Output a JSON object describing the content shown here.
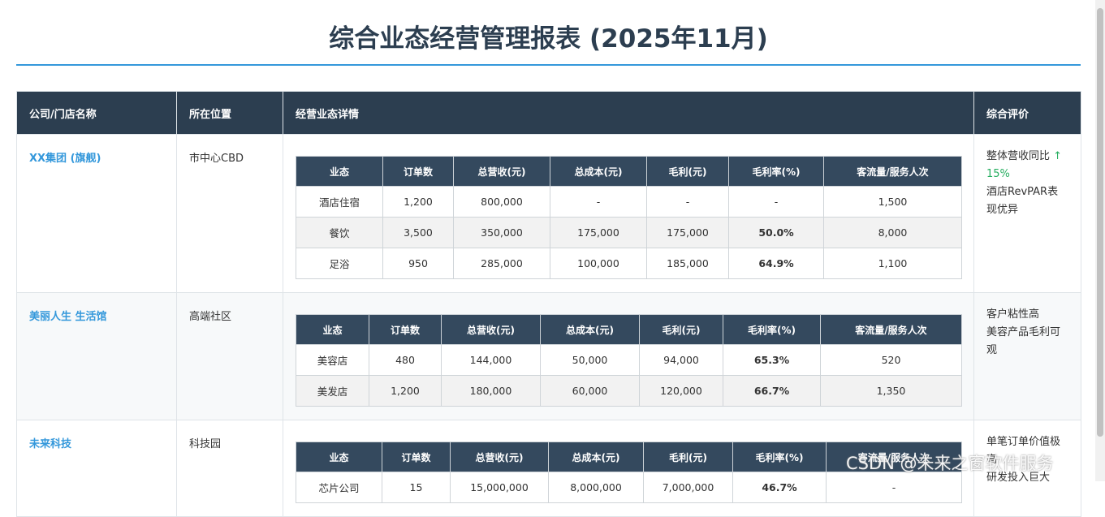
{
  "title": "综合业态经营管理报表 (2025年11月)",
  "headers": [
    "公司/门店名称",
    "所在位置",
    "经营业态详情",
    "综合评价"
  ],
  "sub_headers": [
    "业态",
    "订单数",
    "总营收(元)",
    "总成本(元)",
    "毛利(元)",
    "毛利率(%)",
    "客流量/服务人次"
  ],
  "companies": [
    {
      "name": "XX集团 (旗舰)",
      "location": "市中心CBD",
      "eval_line1": "整体营收同比",
      "eval_trend": "↑ 15%",
      "eval_line2": "酒店RevPAR表现优异",
      "rows": [
        [
          "酒店住宿",
          "1,200",
          "800,000",
          "-",
          "-",
          "-",
          "1,500"
        ],
        [
          "餐饮",
          "3,500",
          "350,000",
          "175,000",
          "175,000",
          "50.0%",
          "8,000"
        ],
        [
          "足浴",
          "950",
          "285,000",
          "100,000",
          "185,000",
          "64.9%",
          "1,100"
        ]
      ]
    },
    {
      "name": "美丽人生 生活馆",
      "location": "高端社区",
      "eval_line1": "客户粘性高",
      "eval_line2": "美容产品毛利可观",
      "rows": [
        [
          "美容店",
          "480",
          "144,000",
          "50,000",
          "94,000",
          "65.3%",
          "520"
        ],
        [
          "美发店",
          "1,200",
          "180,000",
          "60,000",
          "120,000",
          "66.7%",
          "1,350"
        ]
      ]
    },
    {
      "name": "未来科技",
      "location": "科技园",
      "eval_line1": "单笔订单价值极高",
      "eval_line2": "研发投入巨大",
      "rows": [
        [
          "芯片公司",
          "15",
          "15,000,000",
          "8,000,000",
          "7,000,000",
          "46.7%",
          "-"
        ]
      ]
    }
  ],
  "watermark": "CSDN @未来之窗软件服务",
  "colors": {
    "header": "#2c3e50",
    "accent": "#3498db",
    "margin_red": "#e74c3c",
    "up_green": "#27ae60"
  }
}
